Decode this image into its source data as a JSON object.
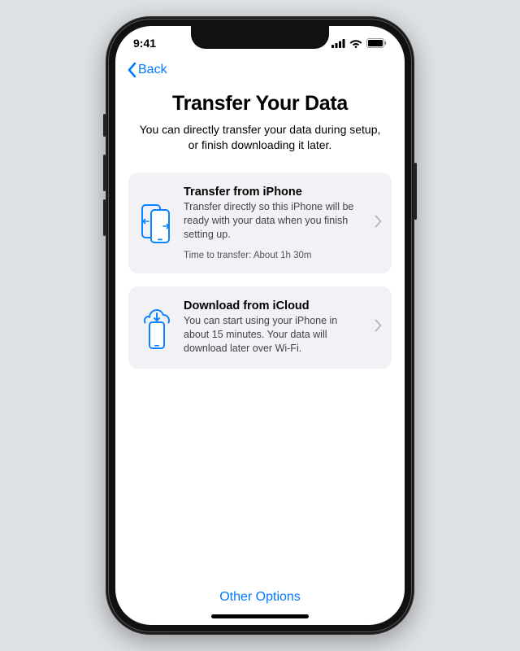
{
  "status": {
    "time": "9:41"
  },
  "nav": {
    "back_label": "Back"
  },
  "header": {
    "title": "Transfer Your Data",
    "subtitle": "You can directly transfer your data during setup, or finish downloading it later."
  },
  "options": {
    "transfer_iphone": {
      "title": "Transfer from iPhone",
      "description": "Transfer directly so this iPhone will be ready with your data when you finish setting up.",
      "meta": "Time to transfer: About 1h 30m"
    },
    "download_icloud": {
      "title": "Download from iCloud",
      "description": "You can start using your iPhone in about 15 minutes. Your data will download later over Wi-Fi."
    }
  },
  "footer": {
    "other_options": "Other Options"
  }
}
